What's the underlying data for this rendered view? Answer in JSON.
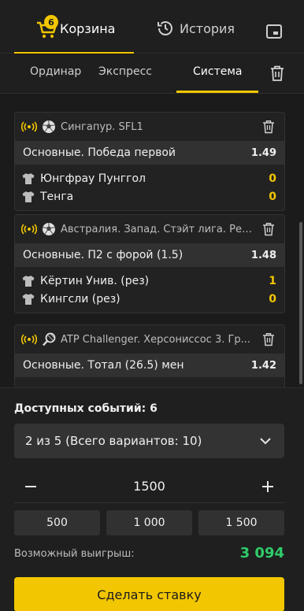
{
  "header": {
    "basket_label": "Корзина",
    "basket_count": "6",
    "history_label": "История"
  },
  "bet_types": {
    "ordinar": "Ординар",
    "express": "Экспресс",
    "system": "Система",
    "active": "system"
  },
  "events": [
    {
      "league": "Сингапур. SFL1",
      "sport_icon": "soccer-ball-icon",
      "market": "Основные. Победа первой",
      "odd": "1.49",
      "teams": [
        {
          "name": "Юнгфрау Пунггол",
          "score": "0"
        },
        {
          "name": "Тенга",
          "score": "0"
        }
      ]
    },
    {
      "league": "Австралия. Запад. Стэйт лига. Рез...",
      "sport_icon": "soccer-ball-icon",
      "market": "Основные. П2 с форой (1.5)",
      "odd": "1.48",
      "teams": [
        {
          "name": "Кёртин Унив. (рез)",
          "score": "1"
        },
        {
          "name": "Кингсли (рез)",
          "score": "0"
        }
      ]
    },
    {
      "league": "ATP Challenger. Херсониссос 3. Гр...",
      "sport_icon": "tennis-racket-icon",
      "market": "Основные. Тотал (26.5) мен",
      "odd": "1.42",
      "teams": []
    }
  ],
  "system": {
    "available_events_label": "Доступных событий: 6",
    "selected_option": "2 из 5 (Всего вариантов: 10)",
    "stake": "1500",
    "quick_amounts": [
      "500",
      "1 000",
      "1 500"
    ],
    "possible_win_label": "Возможный выигрыш:",
    "possible_win_value": "3 094",
    "place_bet_label": "Сделать ставку"
  },
  "colors": {
    "accent": "#f2c600",
    "win": "#2fcc6a",
    "background": "#1b1b1b"
  }
}
